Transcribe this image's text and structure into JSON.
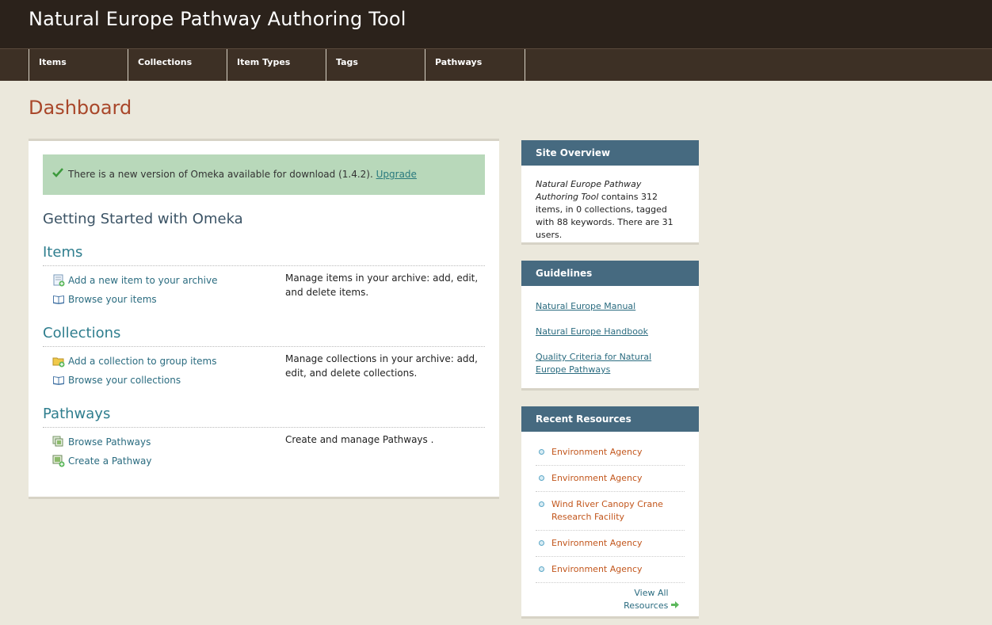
{
  "header": {
    "site_title": "Natural Europe Pathway Authoring Tool"
  },
  "nav": {
    "items": [
      {
        "label": "Items"
      },
      {
        "label": "Collections"
      },
      {
        "label": "Item Types"
      },
      {
        "label": "Tags"
      },
      {
        "label": "Pathways"
      }
    ]
  },
  "page": {
    "title": "Dashboard"
  },
  "alert": {
    "message": "There is a new version of Omeka available for download (1.4.2).",
    "link_label": "Upgrade",
    "icon": "check-icon"
  },
  "main": {
    "heading": "Getting Started with Omeka",
    "sections": [
      {
        "title": "Items",
        "links": [
          {
            "label": "Add a new item to your archive",
            "icon": "add-item-icon"
          },
          {
            "label": "Browse your items",
            "icon": "book-icon"
          }
        ],
        "description": "Manage items in your archive: add, edit, and delete items."
      },
      {
        "title": "Collections",
        "links": [
          {
            "label": "Add a collection to group items",
            "icon": "add-folder-icon"
          },
          {
            "label": "Browse your collections",
            "icon": "book-icon"
          }
        ],
        "description": "Manage collections in your archive: add, edit, and delete collections."
      },
      {
        "title": "Pathways",
        "links": [
          {
            "label": "Browse Pathways",
            "icon": "pathway-browse-icon"
          },
          {
            "label": "Create a Pathway",
            "icon": "pathway-add-icon"
          }
        ],
        "description": "Create and manage Pathways ."
      }
    ]
  },
  "sidebar": {
    "overview": {
      "title": "Site Overview",
      "site_name": "Natural Europe Pathway Authoring Tool",
      "text": " contains 312 items, in 0 collections, tagged with 88 keywords. There are 31 users."
    },
    "guidelines": {
      "title": "Guidelines",
      "links": [
        {
          "label": "Natural Europe Manual"
        },
        {
          "label": "Natural Europe Handbook"
        },
        {
          "label": "Quality Criteria for Natural Europe Pathways"
        }
      ]
    },
    "recent": {
      "title": "Recent Resources",
      "items": [
        {
          "label": "Environment Agency"
        },
        {
          "label": "Environment Agency"
        },
        {
          "label": "Wind River Canopy Crane Research Facility"
        },
        {
          "label": "Environment Agency"
        },
        {
          "label": "Environment Agency"
        }
      ],
      "view_all": "View All Resources"
    }
  },
  "colors": {
    "header_bg": "#2b221b",
    "nav_bg": "#3d3025",
    "page_bg": "#ebe8dc",
    "title": "#a9472a",
    "sidebar_head": "#466a80",
    "alert_bg": "#b8d8ba",
    "resource_link": "#c2561c"
  }
}
